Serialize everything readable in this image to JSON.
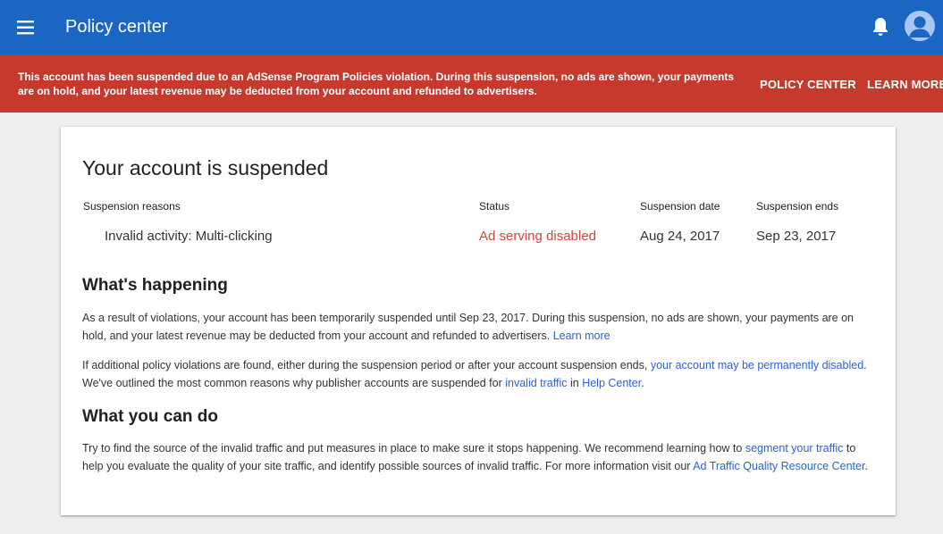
{
  "header": {
    "title": "Policy center",
    "menu_icon": "menu-icon",
    "notification_icon": "bell-icon",
    "avatar_icon": "account-avatar-icon",
    "color": "#1a66c2"
  },
  "banner": {
    "color": "#c53a2c",
    "text": "This account has been suspended due to an AdSense Program Policies violation. During this suspension, no ads are shown, your payments are on hold, and your latest revenue may be deducted from your account and refunded to advertisers.",
    "policy_center_label": "POLICY CENTER",
    "learn_more_label": "LEARN MORE"
  },
  "card": {
    "title": "Your account is suspended",
    "table": {
      "headers": [
        "Suspension reasons",
        "Status",
        "Suspension date",
        "Suspension ends"
      ],
      "row": {
        "reason": "Invalid activity: Multi-clicking",
        "status": "Ad serving disabled",
        "date": "Aug 24, 2017",
        "ends": "Sep 23, 2017"
      }
    },
    "happening": {
      "heading": "What's happening",
      "p1_text": "As a result of violations, your account has been temporarily suspended until Sep 23, 2017. During this suspension, no ads are shown, your payments are on hold, and your latest revenue may be deducted from your account and refunded to advertisers. ",
      "p1_link": "Learn more",
      "p2_text1": "If additional policy violations are found, either during the suspension period or after your account suspension ends, ",
      "p2_link1": "your account may be permanently disabled",
      "p2_text2": ". We've outlined the most common reasons why publisher accounts are suspended for ",
      "p2_link2": "invalid traffic",
      "p2_text3": " in ",
      "p2_link3": "Help Center",
      "p2_text4": "."
    },
    "can_do": {
      "heading": "What you can do",
      "p_text1": "Try to find the source of the invalid traffic and put measures in place to make sure it stops happening. We recommend learning how to ",
      "p_link1": "segment your traffic",
      "p_text2": " to help you evaluate the quality of your site traffic, and identify possible sources of invalid traffic. For more information visit our ",
      "p_link2": "Ad Traffic Quality Resource Center",
      "p_text3": "."
    }
  }
}
